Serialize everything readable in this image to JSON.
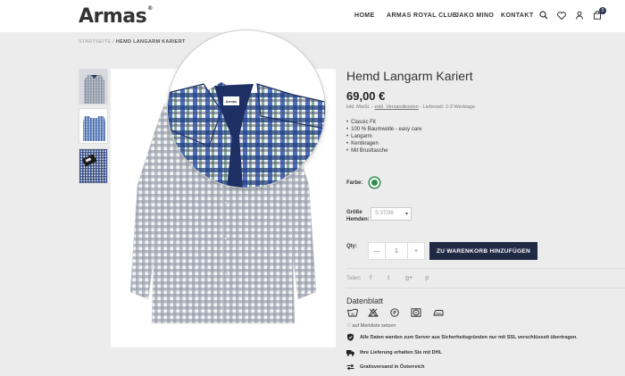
{
  "header": {
    "logo": "Armas",
    "logo_mark": "®",
    "nav": [
      "HOME",
      "ARMAS ROYAL CLUB",
      "JAKO MINO",
      "KONTAKT"
    ],
    "cart_count": "0"
  },
  "breadcrumb": {
    "home": "STARTSEITE",
    "separator": "/",
    "current": "HEMD LANGARM KARIERT"
  },
  "product": {
    "title": "Hemd Langarm Kariert",
    "price": "69,00 €",
    "tax_prefix": "inkl. MwSt. -",
    "shipping_link": "exkl. Versandkosten",
    "delivery": "- Lieferzeit: 2-3 Werktage",
    "features": [
      "Classic Fit",
      "100 % Baumwolle - easy care",
      "Langarm",
      "Kentkragen",
      "Mit Brusttasche"
    ],
    "color_label": "Farbe:",
    "color_value": "#2f8f4a",
    "size_label_1": "Größe",
    "size_label_2": "Hemden:",
    "size_value": "S 37/38",
    "qty_label": "Qty:",
    "qty_minus": "—",
    "qty_value": "1",
    "qty_plus": "+",
    "cart_button": "ZU WARENKORB HINZUFÜGEN"
  },
  "share": {
    "label": "Teilen",
    "icons": [
      "f",
      "t",
      "g+",
      "p"
    ]
  },
  "datenblatt": {
    "title": "Datenblatt",
    "care_icons": [
      "wash-30-icon",
      "no-bleach-icon",
      "dry-clean-p-icon",
      "tumble-dry-icon",
      "iron-icon"
    ]
  },
  "merkliste": "auf Merkliste setzen",
  "info": {
    "security": "Alle Daten werden zum Server aus Sicherheitsgründen nur mit SSL verschlüsselt übertragen.",
    "delivery": "Ihre Lieferung erhalten Sie mit DHL",
    "free_shipping": "Gratisversand in Österreich"
  },
  "colors": {
    "accent": "#1f2a44",
    "swatch": "#2f8f4a",
    "background": "#ececec"
  }
}
